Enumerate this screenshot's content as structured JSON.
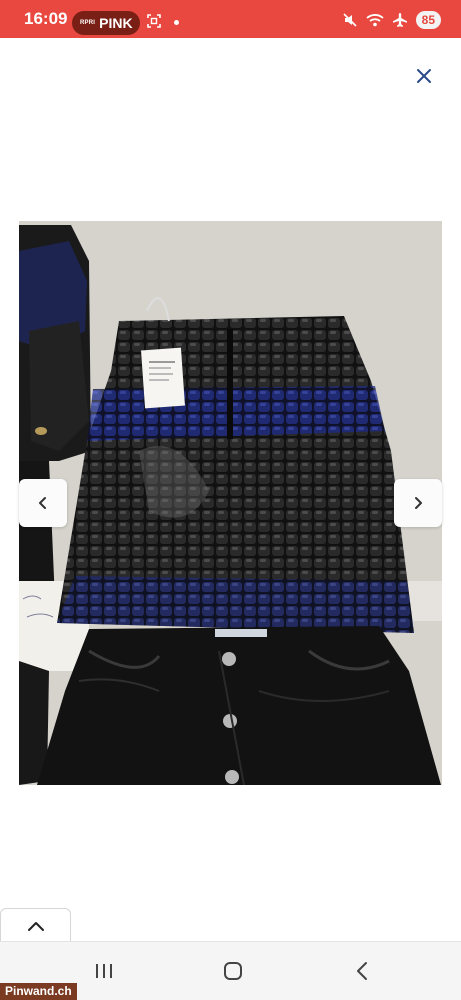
{
  "status_bar": {
    "time": "16:09",
    "pill_small": "RPRI",
    "pill_label": "PINK",
    "battery": "85",
    "icons": [
      "scan-icon",
      "mute-icon",
      "wifi-icon",
      "airplane-icon"
    ]
  },
  "viewer": {
    "close_icon": "close-icon",
    "prev_icon": "chevron-left-icon",
    "next_icon": "chevron-right-icon",
    "photo_subject": "black leather skirts photo"
  },
  "bottom": {
    "collapse_icon": "chevron-up-icon",
    "nav": [
      "recent-apps-icon",
      "home-icon",
      "back-icon"
    ]
  },
  "watermark": "Pinwand.ch",
  "colors": {
    "status_bar": "#e8483f",
    "pill": "#7a1f16",
    "watermark": "#7b3b22"
  }
}
